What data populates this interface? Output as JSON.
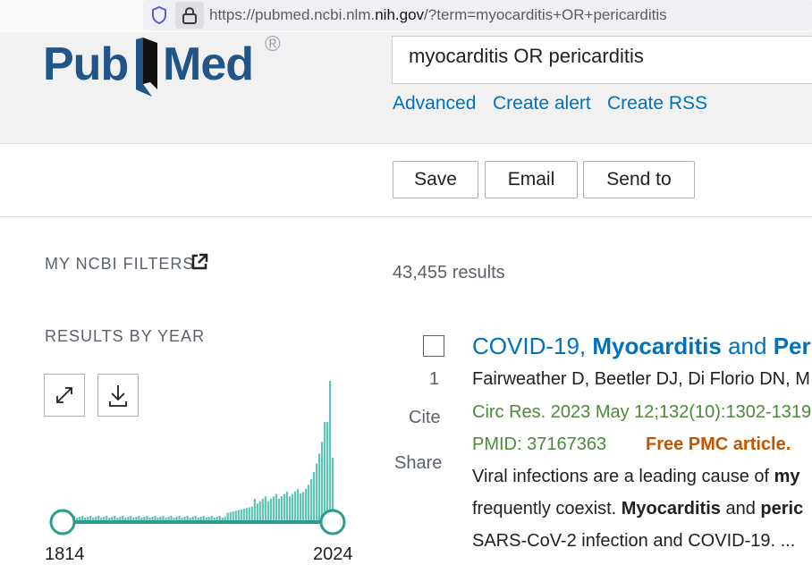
{
  "browser": {
    "url_prefix": "https://pubmed.ncbi.nlm.",
    "url_host": "nih.gov",
    "url_suffix": "/?term=myocarditis+OR+pericarditis"
  },
  "header": {
    "logo_pub": "Pub",
    "logo_med": "Med",
    "logo_reg": "®",
    "search_value": "myocarditis OR pericarditis",
    "links": [
      "Advanced",
      "Create alert",
      "Create RSS"
    ]
  },
  "actions": [
    "Save",
    "Email",
    "Send to"
  ],
  "sidebar": {
    "filters_title": "MY NCBI FILTERS",
    "results_by_year_title": "RESULTS BY YEAR",
    "year_start": "1814",
    "year_end": "2024"
  },
  "results": {
    "count": "43,455 results",
    "items": [
      {
        "index": "1",
        "cite": "Cite",
        "share": "Share",
        "title_a": "COVID-19, ",
        "title_b": "Myocarditis",
        "title_c": " and ",
        "title_d": "Per",
        "authors": "Fairweather D, Beetler DJ, Di Florio DN, M",
        "citation": "Circ Res. 2023 May 12;132(10):1302-1319",
        "pmid": "PMID: 37167363",
        "free": "Free PMC article.",
        "snippet1_a": "Viral infections are a leading cause of ",
        "snippet1_b": "my",
        "snippet2_a": "frequently coexist. ",
        "snippet2_b": "Myocarditis",
        "snippet2_c": " and ",
        "snippet2_d": "peric",
        "snippet3": "SARS-CoV-2 infection and COVID-19. ..."
      }
    ]
  },
  "colors": {
    "brand": "#20558a",
    "link": "#0071bc",
    "timeline": "#2a9d8f",
    "free_pmc": "#c05600"
  }
}
